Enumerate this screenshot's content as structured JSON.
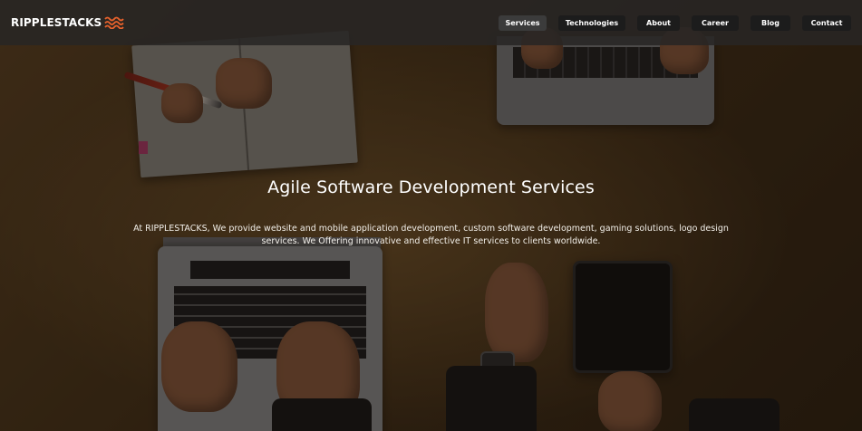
{
  "brand": {
    "name": "RIPPLESTACKS",
    "logo_icon": "waves-icon",
    "accent_color": "#e8622c"
  },
  "nav": {
    "items": [
      {
        "label": "Services",
        "active": true
      },
      {
        "label": "Technologies",
        "active": false
      },
      {
        "label": "About",
        "active": false
      },
      {
        "label": "Career",
        "active": false
      },
      {
        "label": "Blog",
        "active": false
      },
      {
        "label": "Contact",
        "active": false
      }
    ]
  },
  "hero": {
    "title": "Agile Software Development Services",
    "description": "At RIPPLESTACKS, We provide website and mobile application development, custom software development, gaming solutions, logo design services. We Offering innovative and effective IT services to clients worldwide."
  }
}
